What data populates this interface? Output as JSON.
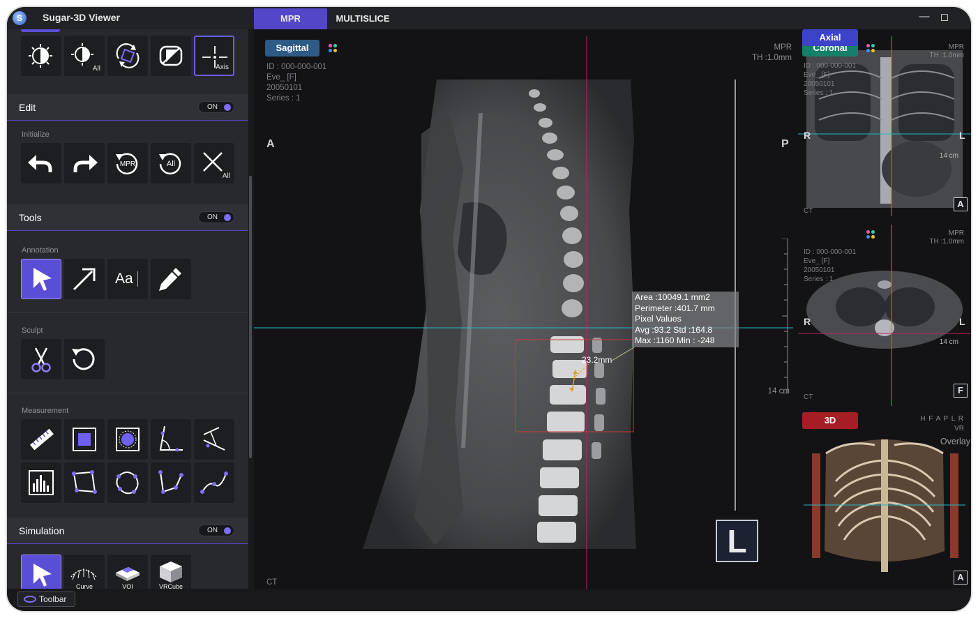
{
  "app": {
    "title": "Sugar-3D Viewer",
    "logo": "S"
  },
  "tabs": [
    {
      "label": "MPR",
      "active": true
    },
    {
      "label": "MULTISLICE",
      "active": false
    }
  ],
  "window": {
    "min_icon": "minimize-icon",
    "max_icon": "maximize-icon"
  },
  "sidebar": {
    "top_row": [
      {
        "icon": "window-level-icon",
        "sub": ""
      },
      {
        "icon": "window-level-all-icon",
        "sub": "All"
      },
      {
        "icon": "rotate-icon",
        "sub": ""
      },
      {
        "icon": "invert-icon",
        "sub": ""
      },
      {
        "icon": "axis-icon",
        "sub": "Axis",
        "highlight": true
      }
    ],
    "edit": {
      "label": "Edit",
      "toggle": "ON",
      "group": "Initialize",
      "buttons": [
        {
          "icon": "undo-icon",
          "sub": ""
        },
        {
          "icon": "redo-icon",
          "sub": ""
        },
        {
          "icon": "reset-mpr-icon",
          "sub": "MPR"
        },
        {
          "icon": "reset-all-icon",
          "sub": "All"
        },
        {
          "icon": "clear-all-icon",
          "sub": "All"
        }
      ]
    },
    "tools": {
      "label": "Tools",
      "toggle": "ON",
      "annotation_label": "Annotation",
      "annotation": [
        {
          "icon": "pointer-icon",
          "selected": true
        },
        {
          "icon": "arrow-icon"
        },
        {
          "icon": "text-icon",
          "text": "Aa"
        },
        {
          "icon": "pencil-icon"
        }
      ],
      "sculpt_label": "Sculpt",
      "sculpt": [
        {
          "icon": "scissors-icon"
        },
        {
          "icon": "reset-sculpt-icon"
        }
      ],
      "measurement_label": "Measurement",
      "measurement": [
        {
          "icon": "ruler-icon"
        },
        {
          "icon": "rect-roi-icon"
        },
        {
          "icon": "ellipse-roi-icon"
        },
        {
          "icon": "angle-icon"
        },
        {
          "icon": "cobb-angle-icon"
        },
        {
          "icon": "histogram-icon"
        },
        {
          "icon": "polygon-icon"
        },
        {
          "icon": "freehand-roi-icon"
        },
        {
          "icon": "polyline-icon"
        },
        {
          "icon": "curve-line-icon"
        }
      ]
    },
    "simulation": {
      "label": "Simulation",
      "toggle": "ON",
      "buttons": [
        {
          "icon": "pointer-icon",
          "sub": "",
          "selected": true
        },
        {
          "icon": "curve-icon",
          "sub": "Curve"
        },
        {
          "icon": "voi-icon",
          "sub": "VOI"
        },
        {
          "icon": "vrcube-icon",
          "sub": "VRCube"
        }
      ]
    },
    "toolbar_label": "Toolbar"
  },
  "sagittal": {
    "tag": "Sagittal",
    "info": [
      "ID : 000-000-001",
      "Eve_ [F]",
      "20050101",
      "Series : 1"
    ],
    "mpr": [
      "MPR",
      "TH :1.0mm"
    ],
    "left": "A",
    "right": "P",
    "scale": "14 cm",
    "modality": "CT",
    "measure": [
      "Area :10049.1  mm2",
      "Perimeter :401.7 mm",
      "Pixel Values",
      "Avg :93.2 Std :164.8",
      "Max :1160   Min : -248"
    ],
    "dist": "23.2mm",
    "orient_box": "L"
  },
  "coronal": {
    "tag": "Coronal",
    "info": [
      "ID : 000-000-001",
      "Eve_ [F]",
      "20050101",
      "Series : 1"
    ],
    "mpr": [
      "MPR",
      "TH :1.0mm"
    ],
    "left": "R",
    "right": "L",
    "scale": "14 cm",
    "modality": "CT",
    "orient_box": "A"
  },
  "axial": {
    "tag": "Axial",
    "info": [
      "ID : 000-000-001",
      "Eve_ [F]",
      "20050101",
      "Series : 1"
    ],
    "mpr": [
      "MPR",
      "TH :1.0mm"
    ],
    "left": "R",
    "right": "L",
    "scale": "14 cm",
    "modality": "CT",
    "orient_box": "F"
  },
  "vr": {
    "tag": "3D",
    "orient": "H F A P L R",
    "mode": "VR",
    "overlay": "Overlay",
    "orient_box": "A"
  },
  "colors": {
    "accent": "#5b4ed6",
    "sagittal": "#2d5b86",
    "coronal": "#14806a",
    "axial": "#3c43c8",
    "vr": "#a61d25",
    "crosshair_cyan": "#22b8c8",
    "crosshair_magenta": "#c21f6a"
  }
}
